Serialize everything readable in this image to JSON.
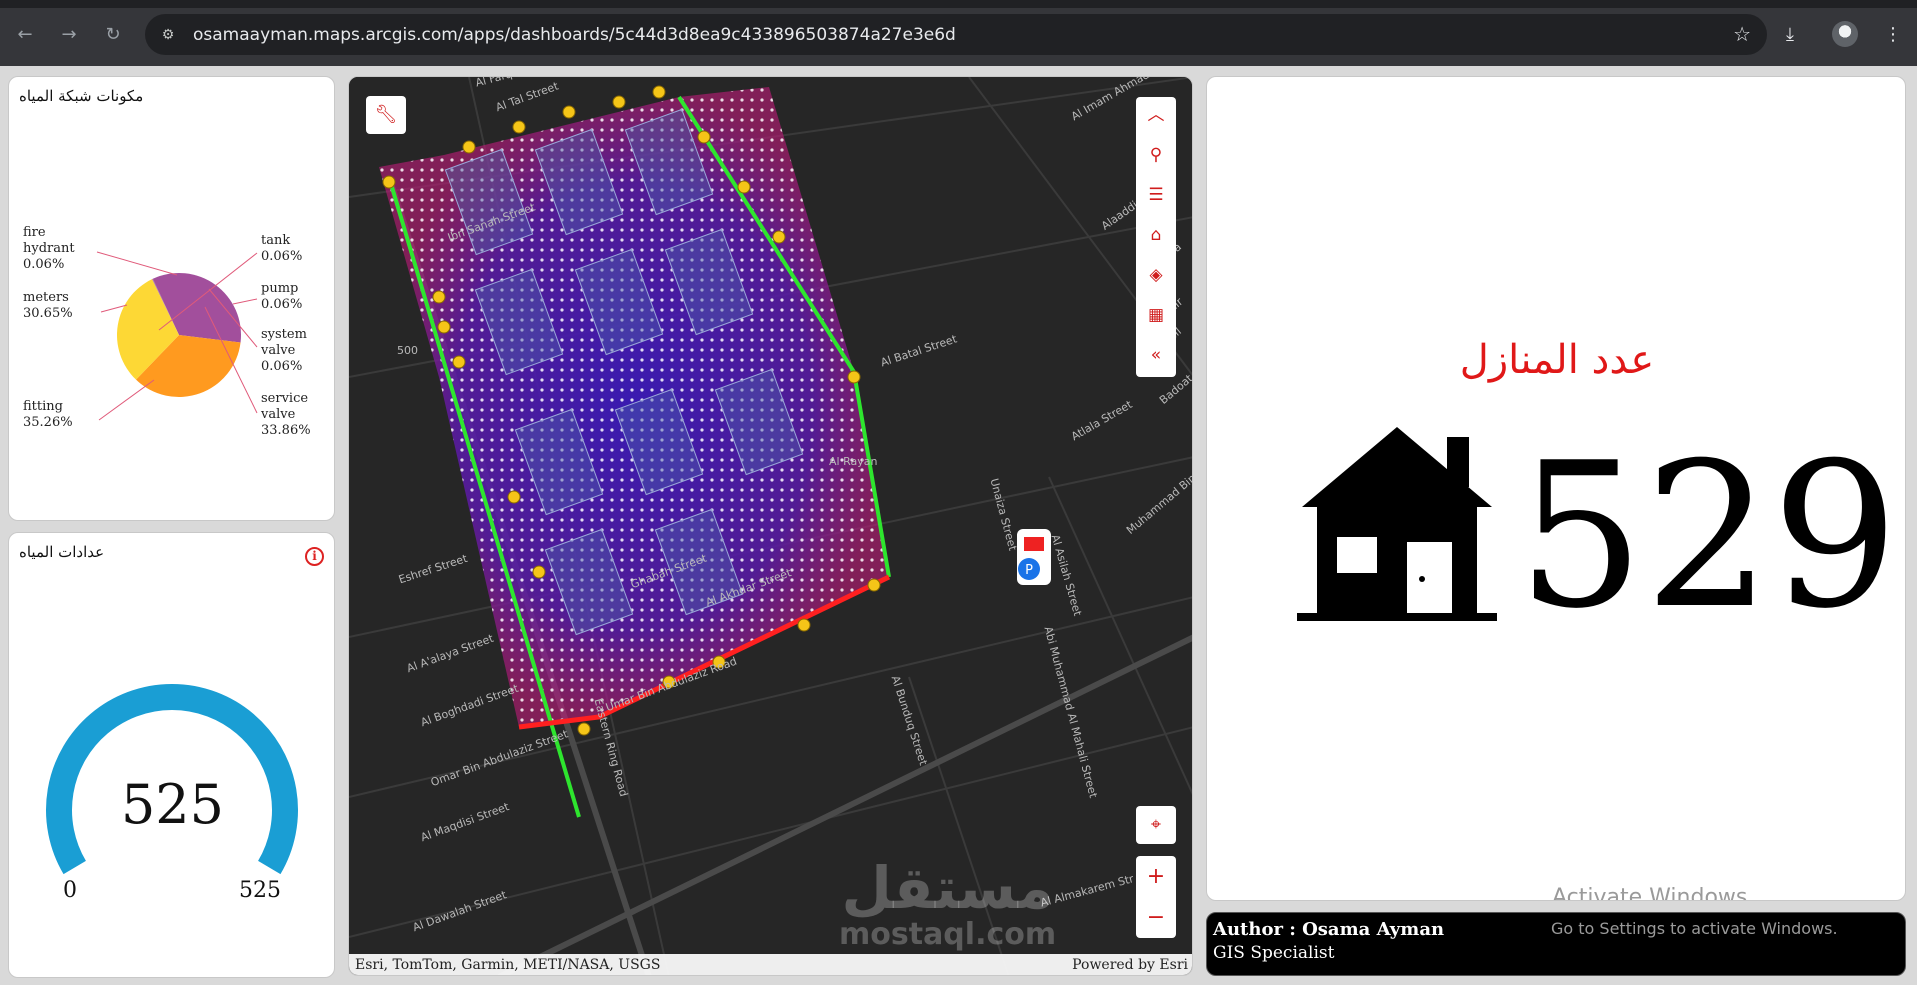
{
  "browser": {
    "url": "osamaayman.maps.arcgis.com/apps/dashboards/5c44d3d8ea9c433896503874a27e3e6d"
  },
  "pie_panel": {
    "title": "مكونات شبكة المياه",
    "chart_data": {
      "type": "pie",
      "categories": [
        "fire hydrant",
        "tank",
        "pump",
        "system valve",
        "service valve",
        "fitting",
        "meters"
      ],
      "values": [
        0.06,
        0.06,
        0.06,
        0.06,
        33.86,
        35.26,
        30.65
      ],
      "colors": [
        "#8b4a9c",
        "#8b4a9c",
        "#8b4a9c",
        "#8b4a9c",
        "#a24f9c",
        "#ff9a1f",
        "#fdd835"
      ],
      "labels": {
        "fire_hydrant": [
          "fire",
          "hydrant",
          "0.06%"
        ],
        "tank": [
          "tank",
          "0.06%"
        ],
        "pump": [
          "pump",
          "0.06%"
        ],
        "system_valve": [
          "system",
          "valve",
          "0.06%"
        ],
        "service_valve": [
          "service",
          "valve",
          "33.86%"
        ],
        "fitting": [
          "fitting",
          "35.26%"
        ],
        "meters": [
          "meters",
          "30.65%"
        ]
      }
    }
  },
  "meter_panel": {
    "title": "عدادات المياه",
    "value": "525",
    "min": "0",
    "max": "525",
    "fraction": 1.0,
    "color": "#1a9ed4"
  },
  "map": {
    "street_labels": [
      "Al Farq",
      "Al Tal Street",
      "Ibn Sanah Street",
      "Al Rayan",
      "Ghabah Street",
      "Al Akhdar Street",
      "Umar Bin Abdulaziz Road",
      "Eastern Ring Road",
      "Eshref Street",
      "Al A'alaya Street",
      "Al Boghdadi Street",
      "Omar Bin Abdulaziz Street",
      "Al Maqdisi Street",
      "Al Dawalah Street",
      "Al Bunduq Street",
      "Unaiza Street",
      "Al Asilah Street",
      "Atlala Street",
      "Abi Muhammad Al Mahali Street",
      "Al Imam Ahmad Bin",
      "Alaaddin Al",
      "Abdulla",
      "Tahir",
      "Badoat Al",
      "Muhammad Bin",
      "Al Almakarem Str",
      "500",
      "Abdull",
      "Al Batal Street"
    ],
    "attribution_left": "Esri, TomTom, Garmin, METI/NASA, USGS",
    "attribution_right": "Powered by Esri",
    "watermark_ar": "مستقل",
    "watermark_en": "mostaql.com",
    "tools": [
      "collapse-up-icon",
      "search-icon",
      "legend-list-icon",
      "home-icon",
      "layers-icon",
      "qr-code-icon",
      "collapse-left-icon"
    ],
    "accent_color": "#d01c1c"
  },
  "houses_panel": {
    "title": "عدد المنازل",
    "value": "529"
  },
  "author": {
    "line1": "Author : Osama Ayman",
    "line2": "GIS Specialist"
  },
  "windows_notice": {
    "line1": "Activate Windows",
    "line2": "Go to Settings to activate Windows."
  }
}
